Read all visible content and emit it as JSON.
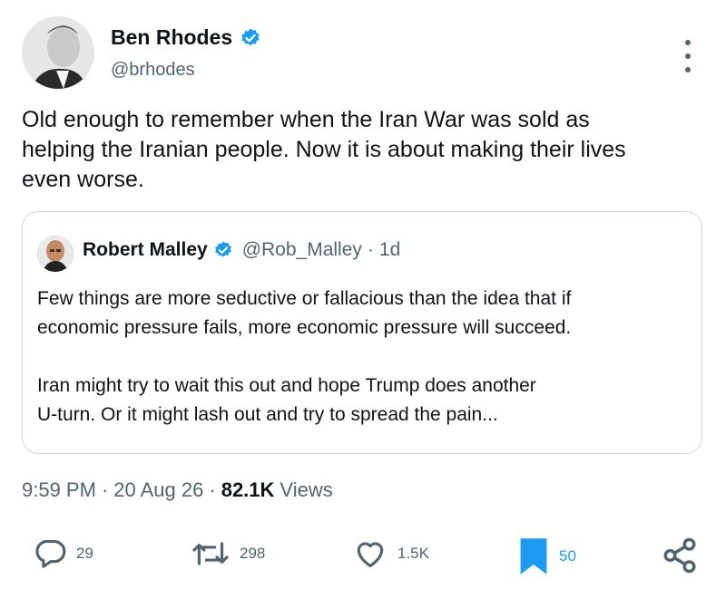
{
  "author": {
    "name": "Ben Rhodes",
    "handle": "@brhodes",
    "verified": true
  },
  "tweet": {
    "text": "Old enough to remember when the Iran War was sold as\nhelping the Iranian people. Now it is about making their lives\neven worse."
  },
  "quoted": {
    "name": "Robert Malley",
    "handle": "@Rob_Malley",
    "separator": "·",
    "time": "1d",
    "text": "Few things are more seductive or fallacious than the idea that if\neconomic pressure fails, more economic pressure will succeed.\n\nIran might try to wait this out and hope Trump does another\nU-turn.  Or it might lash out and try to spread the pain..."
  },
  "meta": {
    "time": "9:59 PM",
    "dot1": "·",
    "date": "20 Aug 26",
    "dot2": "·",
    "views_count": "82.1K",
    "views_label": "Views"
  },
  "actions": {
    "replies": "29",
    "reposts": "298",
    "likes": "1.5K",
    "bookmarks": "50"
  },
  "icons": {
    "verified": "verified-badge-icon",
    "more": "more-icon",
    "reply": "reply-icon",
    "repost": "repost-icon",
    "like": "heart-icon",
    "bookmark": "bookmark-icon",
    "share": "share-icon"
  },
  "colors": {
    "verified_blue": "#1d9bf0",
    "bookmark_blue": "#1d9bf0",
    "text": "#0f1419",
    "muted": "#536471"
  }
}
